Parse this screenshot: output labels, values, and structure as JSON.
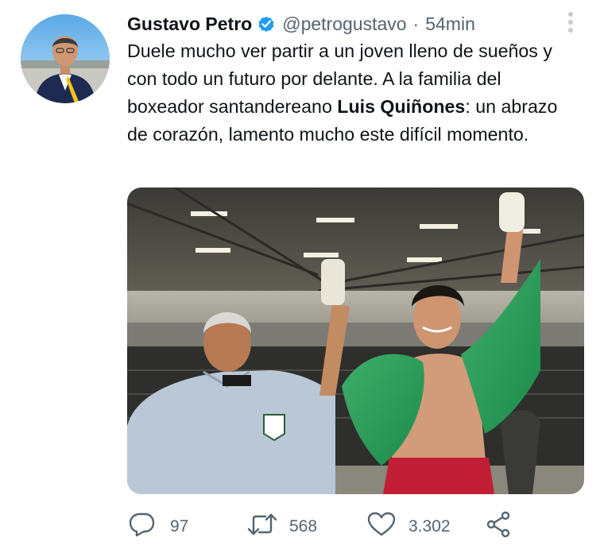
{
  "tweet": {
    "author": {
      "display_name": "Gustavo Petro",
      "handle": "@petrogustavo",
      "verified": true
    },
    "separator": "·",
    "time": "54min",
    "text_part1": "Duele mucho ver partir a un joven lleno de sueños y con todo un futuro por delante. A la familia del boxeador santandereano ",
    "text_bold": "Luis Quiñones",
    "text_part2": ": un abrazo de corazón, lamento mucho este difícil momento.",
    "actions": {
      "replies": "97",
      "retweets": "568",
      "likes": "3.302"
    }
  },
  "colors": {
    "text_primary": "#0f1419",
    "text_secondary": "#536471",
    "verified_blue": "#1d9bf0"
  },
  "icons": [
    "verified-badge-icon",
    "more-options-icon",
    "reply-icon",
    "retweet-icon",
    "like-icon",
    "share-icon"
  ]
}
